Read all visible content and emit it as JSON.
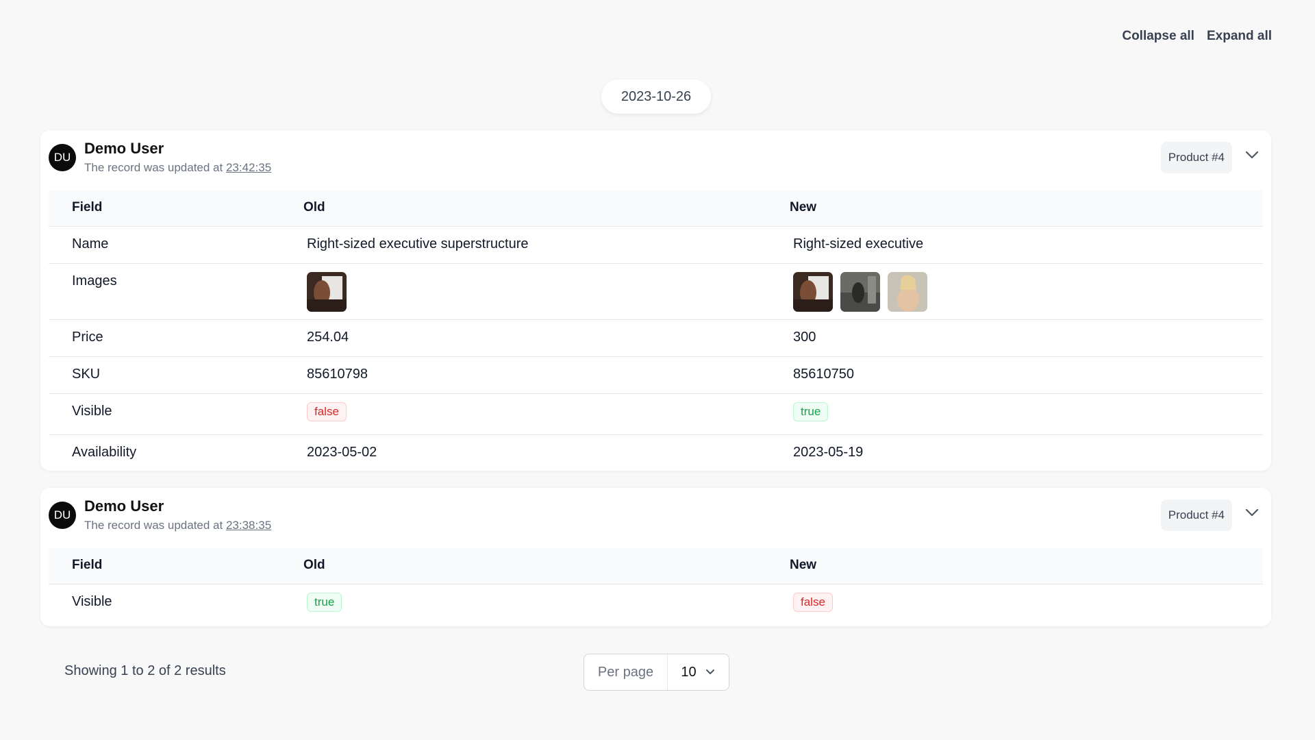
{
  "actions": {
    "collapse_all": "Collapse all",
    "expand_all": "Expand all"
  },
  "date_group": "2023-10-26",
  "table_headers": {
    "field": "Field",
    "old": "Old",
    "new": "New"
  },
  "entries": [
    {
      "avatar": "DU",
      "user": "Demo User",
      "updated_prefix": "The record was updated at",
      "time": "23:42:35",
      "record": "Product #4",
      "rows": [
        {
          "field": "Name",
          "old": "Right-sized executive superstructure",
          "new": "Right-sized executive"
        },
        {
          "field": "Images"
        },
        {
          "field": "Price",
          "old": "254.04",
          "new": "300"
        },
        {
          "field": "SKU",
          "old": "85610798",
          "new": "85610750"
        },
        {
          "field": "Visible",
          "old": "false",
          "new": "true"
        },
        {
          "field": "Availability",
          "old": "2023-05-02",
          "new": "2023-05-19"
        }
      ]
    },
    {
      "avatar": "DU",
      "user": "Demo User",
      "updated_prefix": "The record was updated at",
      "time": "23:38:35",
      "record": "Product #4",
      "rows": [
        {
          "field": "Visible",
          "old": "true",
          "new": "false"
        }
      ]
    }
  ],
  "pagination": {
    "showing": "Showing 1 to 2 of 2 results",
    "per_page_label": "Per page",
    "per_page_value": "10"
  },
  "colors": {
    "false_badge": "#dc2626",
    "true_badge": "#16a34a"
  },
  "icons": {
    "chevron": "chevron-down-icon",
    "thumbnail": "image-thumbnail"
  }
}
